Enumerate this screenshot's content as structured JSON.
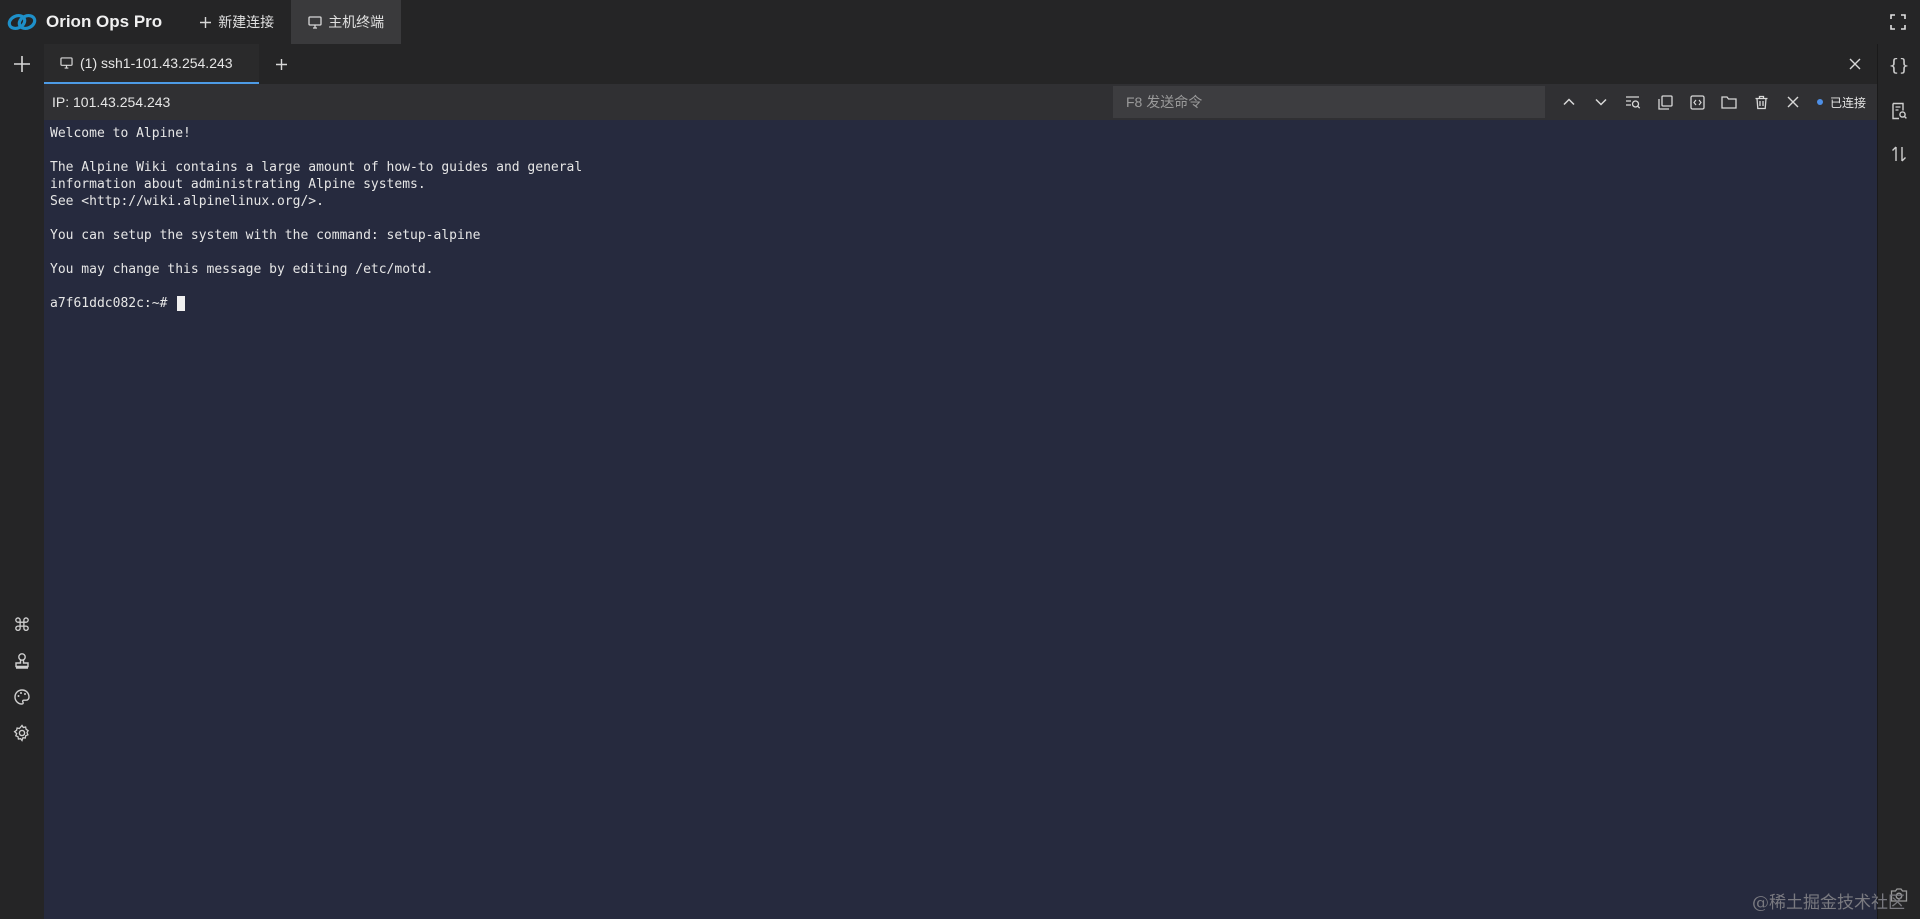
{
  "app": {
    "name": "Orion Ops Pro",
    "logo_color": "#1e90c9"
  },
  "top_tabs": [
    {
      "label": "新建连接",
      "icon": "plus-icon",
      "active": false
    },
    {
      "label": "主机终端",
      "icon": "monitor-icon",
      "active": true
    }
  ],
  "session": {
    "tab_label": "(1) ssh1-101.43.254.243",
    "ip_label": "IP: 101.43.254.243",
    "command_placeholder": "F8 发送命令",
    "status_label": "已连接",
    "status_color": "#4d8fe6"
  },
  "terminal": {
    "lines": [
      "Welcome to Alpine!",
      "",
      "The Alpine Wiki contains a large amount of how-to guides and general",
      "information about administrating Alpine systems.",
      "See <http://wiki.alpinelinux.org/>.",
      "",
      "You can setup the system with the command: setup-alpine",
      "",
      "You may change this message by editing /etc/motd.",
      ""
    ],
    "prompt": "a7f61ddc082c:~# ",
    "background": "#262a3e"
  },
  "right_panel": {
    "snippets_icon_text": "{}"
  },
  "watermark": "@稀土掘金技术社区",
  "accent_color": "#4d9be6"
}
